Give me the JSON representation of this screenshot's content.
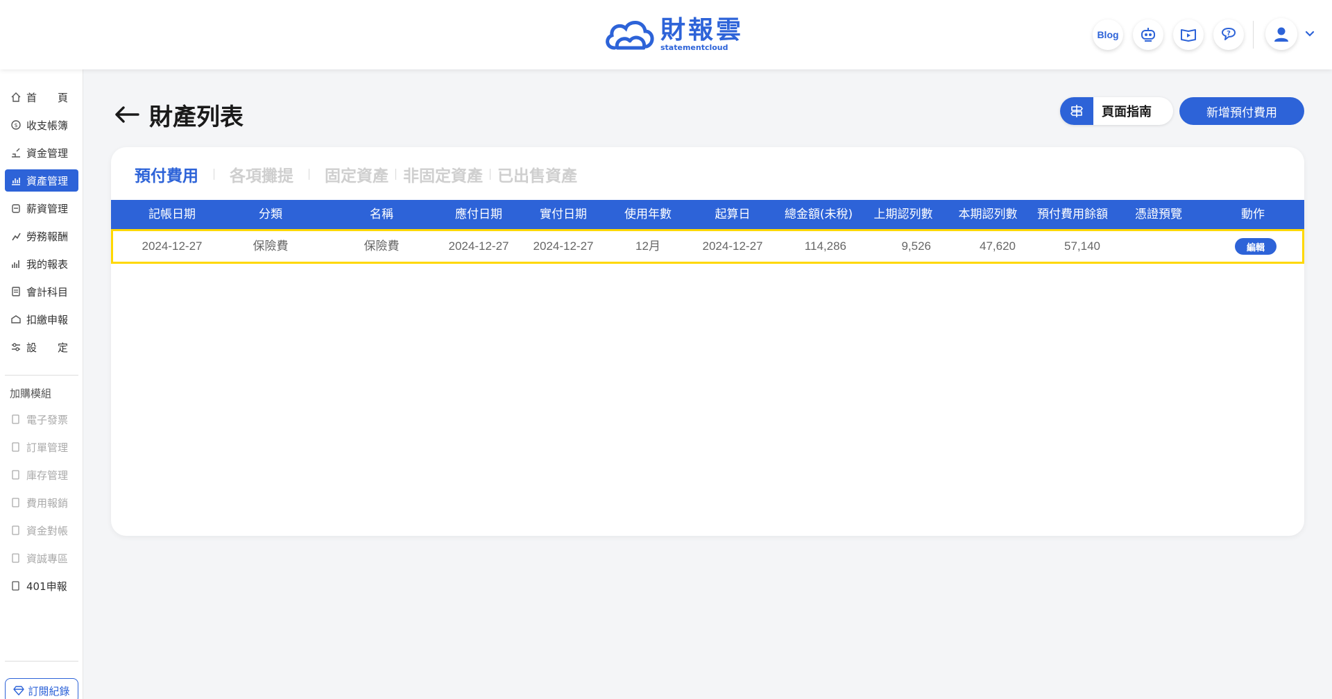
{
  "brand": {
    "name": "財報雲",
    "sub": "statementcloud",
    "color": "#2d63d8"
  },
  "header": {
    "blog_label": "Blog",
    "icons": [
      "robot-icon",
      "video-book-icon",
      "help-chat-icon",
      "user-icon",
      "chevron-down-icon"
    ]
  },
  "sidebar": {
    "items": [
      {
        "label": "首　　頁",
        "icon": "home-icon"
      },
      {
        "label": "收支帳簿",
        "icon": "coin-icon"
      },
      {
        "label": "資金管理",
        "icon": "fund-icon"
      },
      {
        "label": "資產管理",
        "icon": "asset-chart-icon",
        "active": true
      },
      {
        "label": "薪資管理",
        "icon": "salary-icon"
      },
      {
        "label": "勞務報酬",
        "icon": "labor-icon"
      },
      {
        "label": "我的報表",
        "icon": "report-icon"
      },
      {
        "label": "會計科目",
        "icon": "accounting-icon"
      },
      {
        "label": "扣繳申報",
        "icon": "withholding-icon"
      },
      {
        "label": "設　　定",
        "icon": "settings-icon"
      }
    ],
    "addon_title": "加購模組",
    "addons": [
      {
        "label": "電子發票",
        "disabled": true
      },
      {
        "label": "訂單管理",
        "disabled": true
      },
      {
        "label": "庫存管理",
        "disabled": true
      },
      {
        "label": "費用報銷",
        "disabled": true
      },
      {
        "label": "資金對帳",
        "disabled": true
      },
      {
        "label": "資誠專區",
        "disabled": true
      },
      {
        "label": "401申報",
        "disabled": false
      }
    ],
    "subscription_label": "訂閱紀錄"
  },
  "page": {
    "title": "財產列表",
    "guide_label": "頁面指南",
    "add_label": "新增預付費用"
  },
  "tabs": [
    "預付費用",
    "各項攤提",
    "固定資產",
    "非固定資產",
    "已出售資產"
  ],
  "table": {
    "columns": [
      "記帳日期",
      "分類",
      "名稱",
      "應付日期",
      "實付日期",
      "使用年數",
      "起算日",
      "總金額(未稅)",
      "上期認列數",
      "本期認列數",
      "預付費用餘額",
      "憑證預覽",
      "動作"
    ],
    "rows": [
      {
        "date": "2024-12-27",
        "category": "保險費",
        "name": "保險費",
        "payable_date": "2024-12-27",
        "paid_date": "2024-12-27",
        "years": "12月",
        "start_date": "2024-12-27",
        "total": "114,286",
        "prev": "9,526",
        "current": "47,620",
        "balance": "57,140",
        "voucher": "",
        "action": "編輯"
      }
    ]
  }
}
